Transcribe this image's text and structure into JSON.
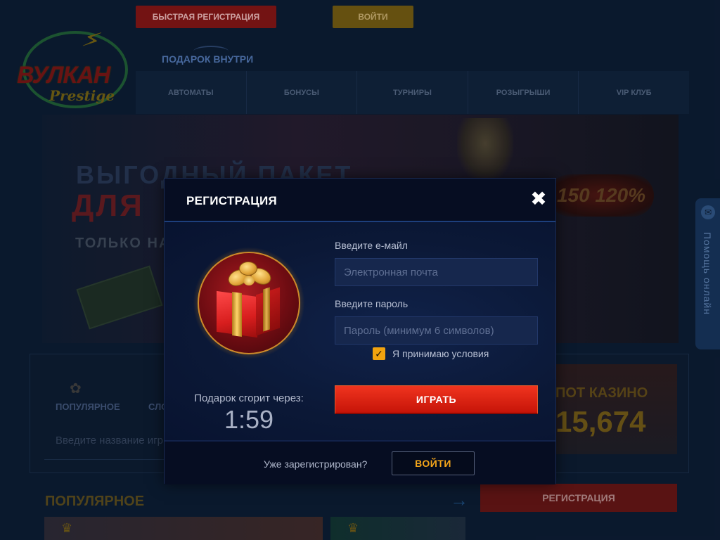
{
  "header": {
    "quick_register_label": "БЫСТРАЯ РЕГИСТРАЦИЯ",
    "login_label": "ВОЙТИ",
    "gift_inside_label": "ПОДАРОК ВНУТРИ"
  },
  "logo": {
    "main_text": "ВУЛКАН",
    "sub_text": "Prestige"
  },
  "nav": {
    "items": [
      {
        "label": "АВТОМАТЫ"
      },
      {
        "label": "БОНУСЫ"
      },
      {
        "label": "ТУРНИРЫ"
      },
      {
        "label": "РОЗЫГРЫШИ"
      },
      {
        "label": "VIP КЛУБ"
      }
    ]
  },
  "banner": {
    "line1": "ВЫГОДНЫЙ ПАКЕТ",
    "line2": "ДЛЯ",
    "line3": "ТОЛЬКО НА",
    "percent_badge": "150 120%"
  },
  "help": {
    "label": "Помощь онлайн"
  },
  "games": {
    "category_popular": "ПОПУЛЯРНОЕ",
    "category_slots": "СЛО",
    "search_placeholder": "Введите название игр",
    "popular_heading": "ПОПУЛЯРНОЕ",
    "register_label": "РЕГИСТРАЦИЯ"
  },
  "jackpot": {
    "title": "ПОТ КАЗИНО",
    "value": "15,674"
  },
  "modal": {
    "title": "РЕГИСТРАЦИЯ",
    "close_icon": "close-icon",
    "email_label": "Введите е-майл",
    "email_placeholder": "Электронная почта",
    "email_value": "",
    "password_label": "Введите пароль",
    "password_placeholder": "Пароль (минимум 6 символов)",
    "password_value": "",
    "terms_label": "Я принимаю условия",
    "terms_checked": true,
    "timer_label": "Подарок сгорит через:",
    "timer_value": "1:59",
    "play_label": "ИГРАТЬ",
    "already_registered": "Уже зарегистрирован?",
    "login_label": "ВОЙТИ"
  },
  "colors": {
    "accent_orange": "#f1a30f",
    "play_red": "#e02a14",
    "modal_bg": "#071028"
  }
}
